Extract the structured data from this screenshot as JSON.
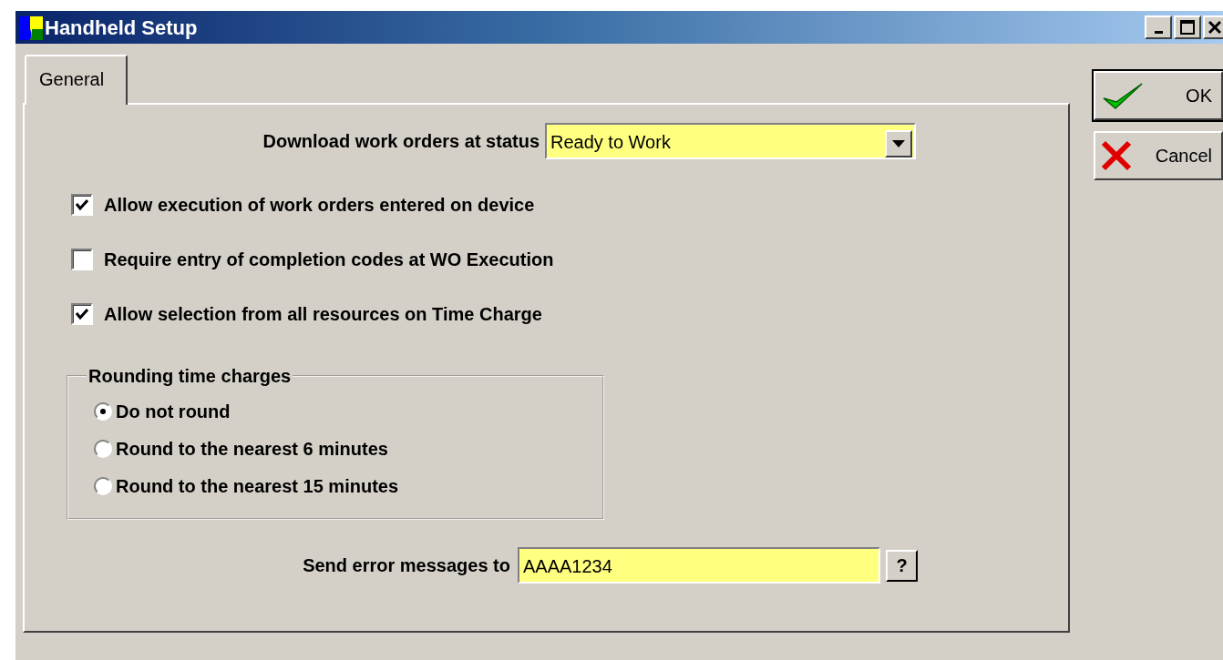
{
  "window": {
    "title": "Handheld Setup"
  },
  "tabs": [
    {
      "label": "General",
      "selected": true
    }
  ],
  "status_field": {
    "label": "Download work orders at status",
    "value": "Ready to Work"
  },
  "options": [
    {
      "label": "Allow execution of work orders entered on device",
      "checked": true
    },
    {
      "label": "Require entry of completion codes at WO Execution",
      "checked": false
    },
    {
      "label": "Allow selection from all resources on Time Charge",
      "checked": true
    }
  ],
  "rounding": {
    "title": "Rounding time charges",
    "choices": [
      {
        "label": "Do not round",
        "selected": true
      },
      {
        "label": "Round to the nearest 6 minutes",
        "selected": false
      },
      {
        "label": "Round to the nearest 15 minutes",
        "selected": false
      }
    ]
  },
  "error_field": {
    "label": "Send error messages to",
    "value": "AAAA1234"
  },
  "help_button": "?",
  "buttons": [
    {
      "label": "OK",
      "kind": "ok"
    },
    {
      "label": "Cancel",
      "kind": "cancel"
    }
  ]
}
